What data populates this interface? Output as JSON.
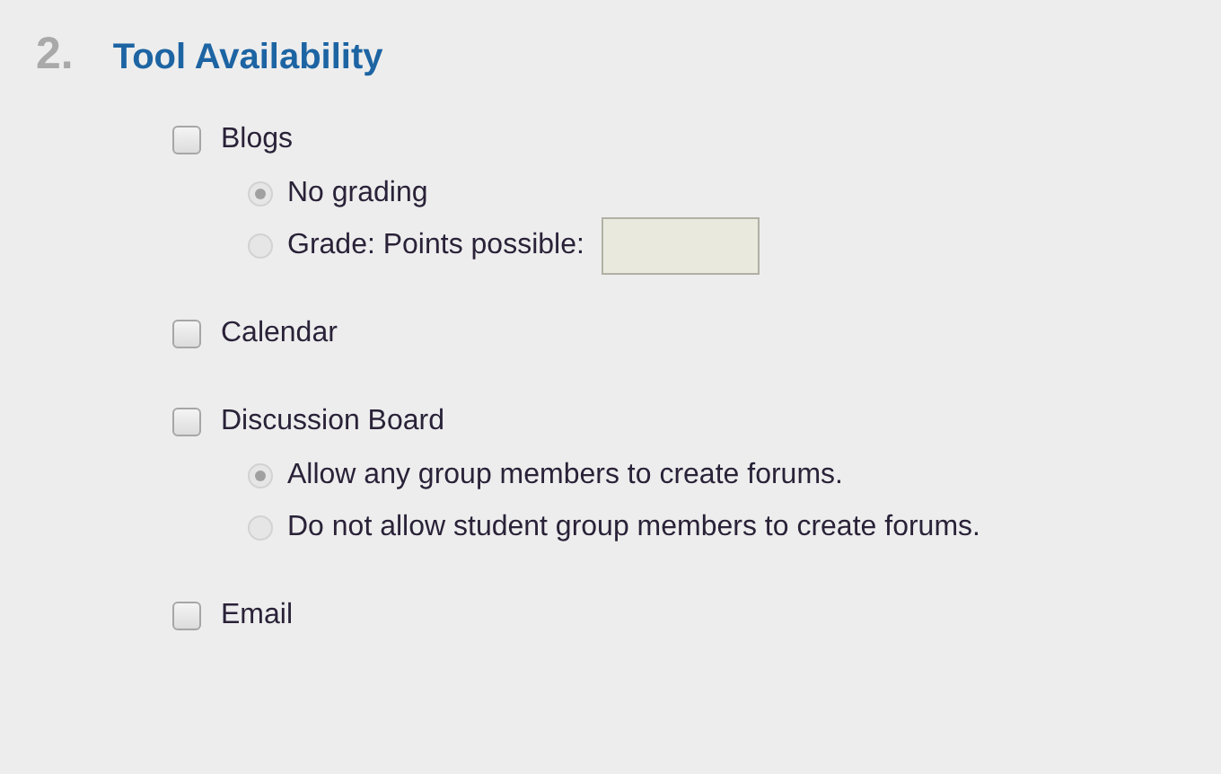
{
  "section": {
    "number": "2.",
    "title": "Tool Availability"
  },
  "tools": [
    {
      "label": "Blogs",
      "checked": false,
      "options": [
        {
          "kind": "plain",
          "label": "No grading",
          "selected": true,
          "disabled": true
        },
        {
          "kind": "field",
          "label": "Grade: Points possible:",
          "selected": false,
          "disabled": true
        }
      ]
    },
    {
      "label": "Calendar",
      "checked": false
    },
    {
      "label": "Discussion Board",
      "checked": false,
      "options": [
        {
          "kind": "plain",
          "label": "Allow any group members to create forums.",
          "selected": true,
          "disabled": true
        },
        {
          "kind": "plain",
          "label": "Do not allow student group members to create forums.",
          "selected": false,
          "disabled": true
        }
      ]
    },
    {
      "label": "Email",
      "checked": false
    }
  ]
}
